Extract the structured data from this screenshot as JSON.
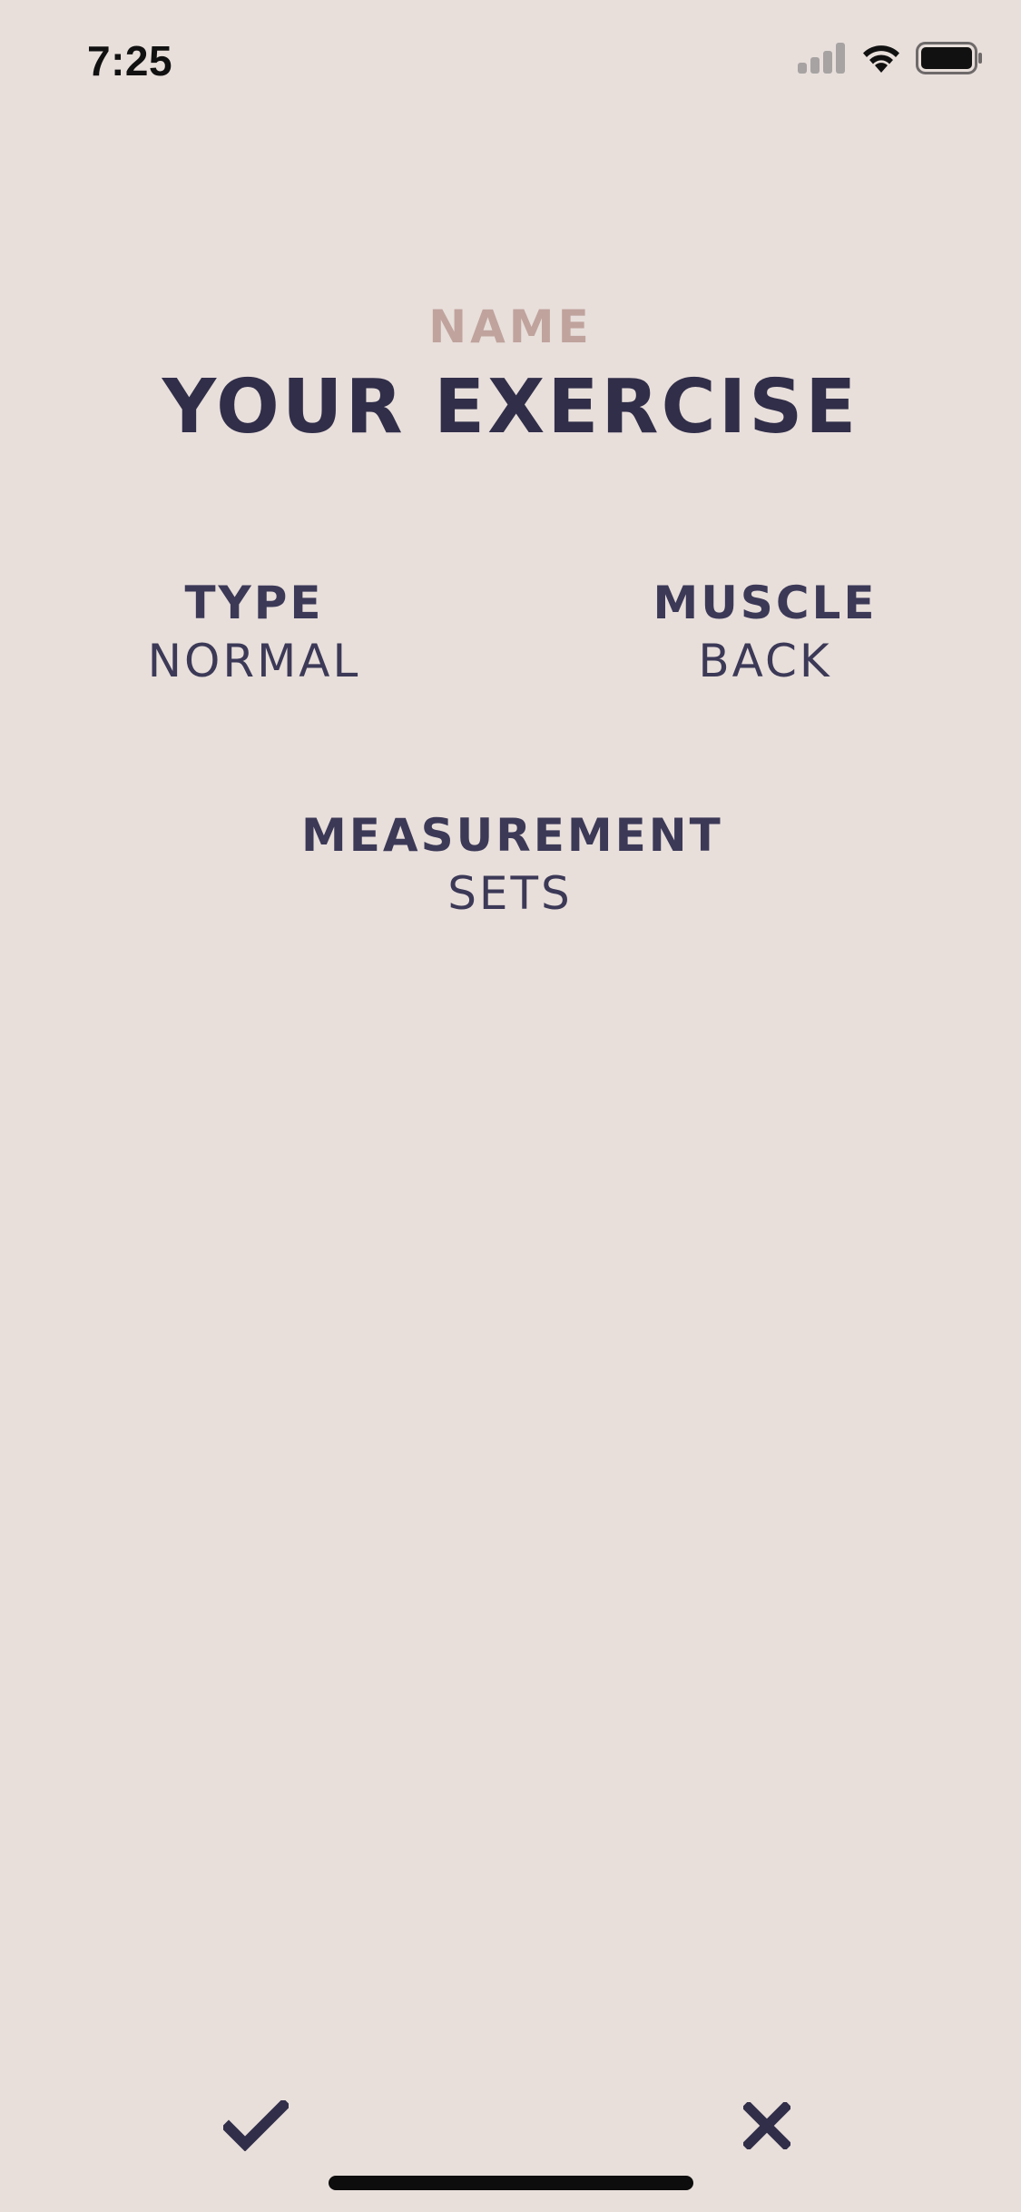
{
  "status_bar": {
    "time": "7:25",
    "icons": [
      "cellular-signal-icon",
      "wifi-icon",
      "battery-icon"
    ]
  },
  "exercise": {
    "name_label": "NAME",
    "name_value": "YOUR EXERCISE"
  },
  "fields": {
    "type": {
      "label": "TYPE",
      "value": "NORMAL"
    },
    "muscle": {
      "label": "MUSCLE",
      "value": "BACK"
    },
    "measurement": {
      "label": "MEASUREMENT",
      "value": "SETS"
    }
  },
  "actions": {
    "confirm_icon": "checkmark-icon",
    "cancel_icon": "close-icon"
  },
  "colors": {
    "background": "#e8dfdb",
    "accent_label": "#c0a39d",
    "primary_text": "#312e49",
    "secondary_text": "#3c3957"
  }
}
